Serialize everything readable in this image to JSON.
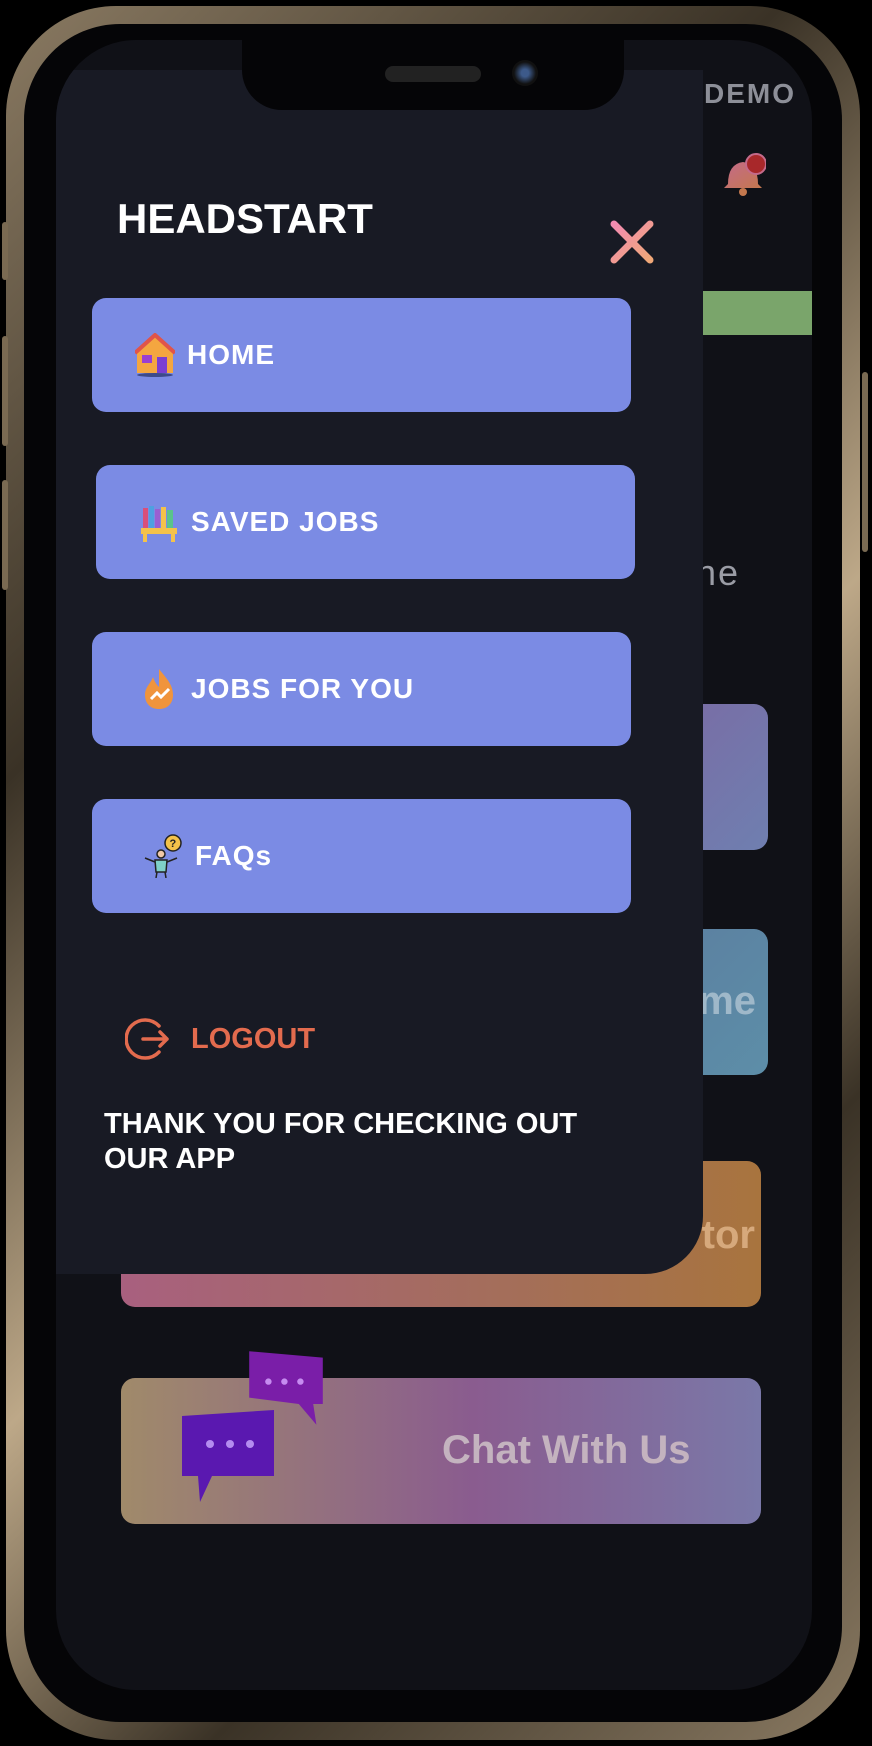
{
  "app": {
    "title": "HEADSTART",
    "demo_label": "DEMO"
  },
  "drawer": {
    "close_icon": "close-icon",
    "items": [
      {
        "label": "HOME",
        "icon": "house-icon"
      },
      {
        "label": "SAVED JOBS",
        "icon": "bookshelf-icon"
      },
      {
        "label": "JOBS FOR YOU",
        "icon": "flame-trend-icon"
      },
      {
        "label": "FAQs",
        "icon": "question-person-icon"
      }
    ],
    "logout_label": "LOGOUT",
    "footer": "THANK YOU FOR CHECKING OUT OUR APP"
  },
  "background": {
    "partial_text_1": "he",
    "partial_text_2": "me",
    "partial_text_3": "tor",
    "chat_label": "Chat With Us"
  },
  "colors": {
    "drawer_bg": "#181a24",
    "menu_item_bg": "#7b8be4",
    "logout": "#e36b4e",
    "close_gradient_start": "#f28bb1",
    "close_gradient_end": "#f0a878",
    "green_bar": "#7aa56b"
  }
}
